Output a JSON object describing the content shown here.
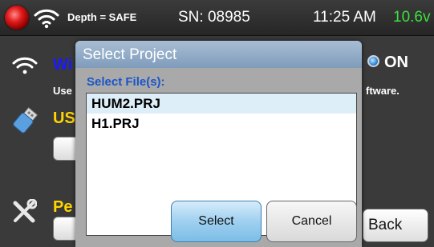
{
  "status_bar": {
    "depth_text": "Depth = SAFE",
    "serial": "SN: 08985",
    "time": "11:25 AM",
    "voltage": "10.6v",
    "voltage_color": "#3ee03e",
    "record_indicator_color": "#e11c1c"
  },
  "background": {
    "wifi_title": "Wi",
    "wifi_note": "Use",
    "wifi_note_tail": "ftware.",
    "wifi_status": "ON",
    "usb_title": "US",
    "perf_title": "Pe",
    "back_label": "Back"
  },
  "dialog": {
    "title": "Select Project",
    "list_label": "Select File(s):",
    "files": [
      {
        "name": "HUM2.PRJ",
        "selected": true
      },
      {
        "name": "H1.PRJ",
        "selected": false
      }
    ],
    "select_label": "Select",
    "cancel_label": "Cancel"
  },
  "icons": [
    "record-icon",
    "wifi-icon",
    "usb-drive-icon",
    "tools-icon",
    "led-indicator-icon"
  ]
}
